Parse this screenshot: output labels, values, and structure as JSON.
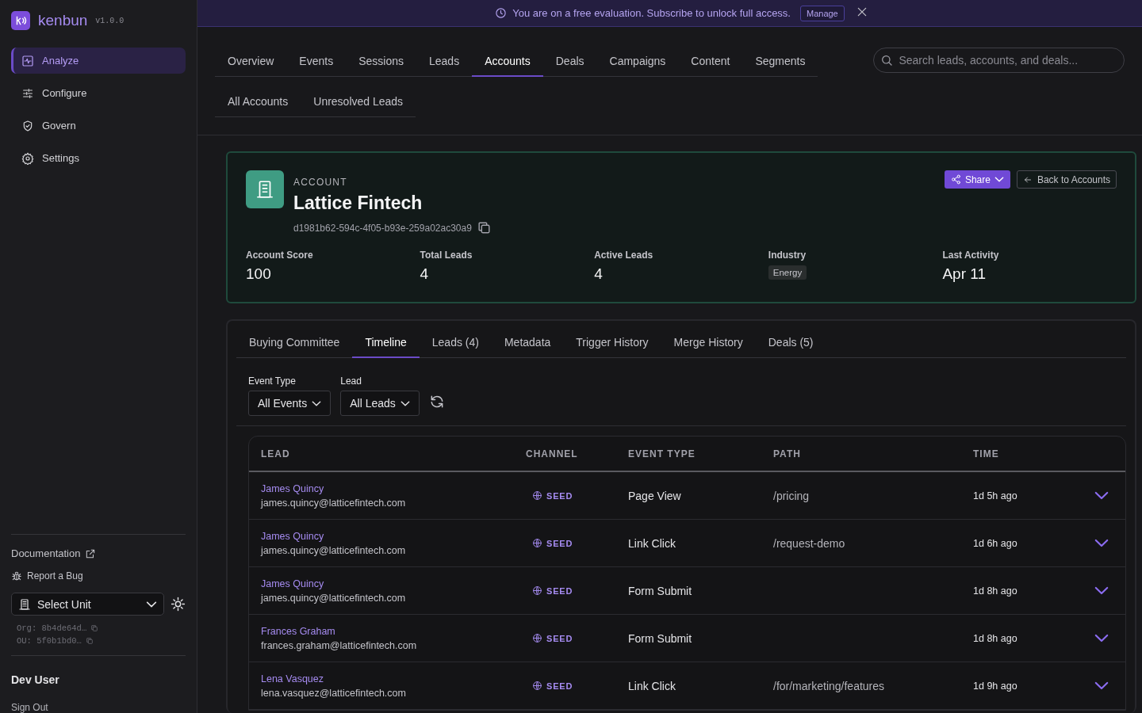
{
  "brand": {
    "name": "kenbun",
    "version": "v1.0.0"
  },
  "sidebar": {
    "items": [
      {
        "label": "Analyze",
        "selected": true
      },
      {
        "label": "Configure",
        "selected": false
      },
      {
        "label": "Govern",
        "selected": false
      },
      {
        "label": "Settings",
        "selected": false
      }
    ],
    "links": [
      {
        "label": "Documentation",
        "kind": "external"
      },
      {
        "label": "Report a Bug",
        "kind": "bug"
      }
    ],
    "unit_select": {
      "value": "Select Unit"
    },
    "ids": [
      "Org: 8b4de64d…",
      "OU: 5f0b1bd0…"
    ],
    "user": "Dev User",
    "sign_out": "Sign Out"
  },
  "banner": {
    "message": "You are on a free evaluation. Subscribe to unlock full access.",
    "button": "Manage"
  },
  "tabs": [
    {
      "label": "Overview",
      "selected": false
    },
    {
      "label": "Events",
      "selected": false
    },
    {
      "label": "Sessions",
      "selected": false
    },
    {
      "label": "Leads",
      "selected": false
    },
    {
      "label": "Accounts",
      "selected": true
    },
    {
      "label": "Deals",
      "selected": false
    },
    {
      "label": "Campaigns",
      "selected": false
    },
    {
      "label": "Content",
      "selected": false
    },
    {
      "label": "Segments",
      "selected": false
    }
  ],
  "search": {
    "placeholder": "Search leads, accounts, and deals..."
  },
  "subtabs": [
    {
      "label": "All Accounts",
      "selected": false
    },
    {
      "label": "Unresolved Leads",
      "selected": false
    }
  ],
  "account": {
    "kicker": "ACCOUNT",
    "name": "Lattice Fintech",
    "id": "d1981b62-594c-4f05-b93e-259a02ac30a9",
    "share": "Share",
    "back": "Back to Accounts",
    "stats": [
      {
        "label": "Account Score",
        "value": "100",
        "kind": "text"
      },
      {
        "label": "Total Leads",
        "value": "4",
        "kind": "text"
      },
      {
        "label": "Active Leads",
        "value": "4",
        "kind": "text"
      },
      {
        "label": "Industry",
        "value": "Energy",
        "kind": "tag"
      },
      {
        "label": "Last Activity",
        "value": "Apr 11",
        "kind": "text"
      }
    ]
  },
  "detail_tabs": [
    {
      "label": "Buying Committee",
      "selected": false
    },
    {
      "label": "Timeline",
      "selected": true
    },
    {
      "label": "Leads (4)",
      "selected": false
    },
    {
      "label": "Metadata",
      "selected": false
    },
    {
      "label": "Trigger History",
      "selected": false
    },
    {
      "label": "Merge History",
      "selected": false
    },
    {
      "label": "Deals (5)",
      "selected": false
    }
  ],
  "filters": [
    {
      "label": "Event Type",
      "value": "All Events"
    },
    {
      "label": "Lead",
      "value": "All Leads"
    }
  ],
  "table": {
    "columns": [
      "LEAD",
      "CHANNEL",
      "EVENT TYPE",
      "PATH",
      "TIME"
    ],
    "rows": [
      {
        "name": "James Quincy",
        "email": "james.quincy@latticefintech.com",
        "channel": "SEED",
        "event_type": "Page View",
        "path": "/pricing",
        "time": "1d 5h ago"
      },
      {
        "name": "James Quincy",
        "email": "james.quincy@latticefintech.com",
        "channel": "SEED",
        "event_type": "Link Click",
        "path": "/request-demo",
        "time": "1d 6h ago"
      },
      {
        "name": "James Quincy",
        "email": "james.quincy@latticefintech.com",
        "channel": "SEED",
        "event_type": "Form Submit",
        "time": "1d 8h ago"
      },
      {
        "name": "Frances Graham",
        "email": "frances.graham@latticefintech.com",
        "channel": "SEED",
        "event_type": "Form Submit",
        "time": "1d 8h ago"
      },
      {
        "name": "Lena Vasquez",
        "email": "lena.vasquez@latticefintech.com",
        "channel": "SEED",
        "event_type": "Link Click",
        "path": "/for/marketing/features",
        "time": "1d 9h ago"
      }
    ]
  }
}
